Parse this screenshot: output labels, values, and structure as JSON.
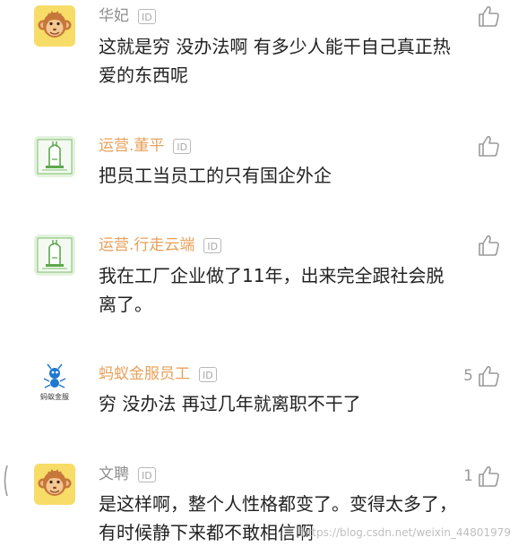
{
  "colors": {
    "username_gray": "#8f8f8f",
    "username_orange": "#e6a15a",
    "text": "#222222",
    "icon_gray": "#999999"
  },
  "comments": [
    {
      "username": "华妃",
      "id_badge": "ID",
      "avatar_icon": "monkey-avatar-icon",
      "text": "这就是穷 没办法啊 有多少人能干自己真正热爱的东西呢",
      "likes": ""
    },
    {
      "username": "运营.董平",
      "id_badge": "ID",
      "avatar_icon": "green-tower-avatar-icon",
      "text": "把员工当员工的只有国企外企",
      "likes": ""
    },
    {
      "username": "运营.行走云端",
      "id_badge": "ID",
      "avatar_icon": "green-tower-avatar-icon",
      "text": "我在工厂企业做了11年，出来完全跟社会脱离了。",
      "likes": ""
    },
    {
      "username": "蚂蚁金服员工",
      "id_badge": "ID",
      "avatar_icon": "ant-financial-logo-icon",
      "avatar_caption": "蚂蚁金服",
      "text": "穷 没办法 再过几年就离职不干了",
      "likes": "5"
    },
    {
      "username": "文聘",
      "id_badge": "ID",
      "avatar_icon": "monkey-avatar-icon",
      "text": "是这样啊，整个人性格都变了。变得太多了，有时候静下来都不敢相信啊",
      "likes": "1"
    }
  ],
  "watermark": "https://blog.csdn.net/weixin_44801979"
}
